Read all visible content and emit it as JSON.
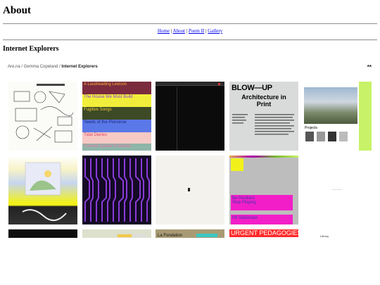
{
  "page": {
    "heading": "About"
  },
  "nav": {
    "links": [
      "Home",
      "About",
      "Poem II",
      "Gallery"
    ],
    "sep": "|"
  },
  "section": {
    "heading": "Internet Explorers"
  },
  "breadcrumb": {
    "items": [
      "Are.na",
      "Gemma Copeland",
      "Internet Explorers"
    ],
    "sep": "/"
  },
  "menu_glyph": "**",
  "tiles": {
    "t2": {
      "lines": [
        "A Loudreading Lexicon",
        "The House We Must Build",
        "Fugitive Songs",
        "Seeds of the Plurverse",
        "Tidal Diaries",
        "Formed Spatial Practices"
      ]
    },
    "t4": {
      "title": "BLOW—UP",
      "sub": "Architecture in Print"
    },
    "t5": {
      "caption": "Projects"
    },
    "t9": {
      "line1": "Be Resilient",
      "line2": "Stop Playing",
      "line3": "Hit Stalemate"
    },
    "t14": {
      "text": "URGENT PEDAGOGIES"
    },
    "t15": {
      "text": "Library"
    },
    "t12": {
      "text": "La Fondation"
    }
  },
  "colors": {
    "link": "#0000ee",
    "purple": "#8a3cd8",
    "magenta": "#f21fc8",
    "lime": "#c8f268",
    "yellow": "#f2f11c",
    "urgent": "#ff2a2a"
  }
}
